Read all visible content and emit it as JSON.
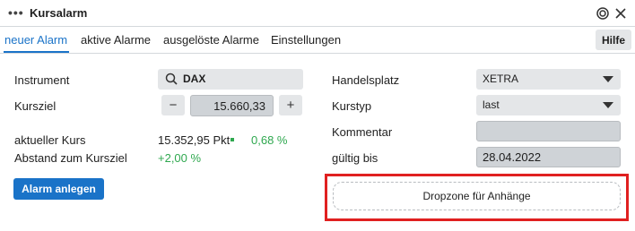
{
  "window": {
    "title": "Kursalarm",
    "menu_icon": "more-dots-icon",
    "settings_icon": "ring-icon",
    "close_icon": "close-icon"
  },
  "tabs": [
    {
      "label": "neuer Alarm",
      "active": true
    },
    {
      "label": "aktive Alarme",
      "active": false
    },
    {
      "label": "ausgelöste Alarme",
      "active": false
    },
    {
      "label": "Einstellungen",
      "active": false
    }
  ],
  "help_label": "Hilfe",
  "form": {
    "instrument_label": "Instrument",
    "instrument_value": "DAX",
    "kursziel_label": "Kursziel",
    "kursziel_value": "15.660,33",
    "minus": "−",
    "plus": "+",
    "aktueller_kurs_label": "aktueller Kurs",
    "aktueller_kurs_value": "15.352,95 Pkt",
    "aktueller_kurs_change": "0,68 %",
    "abstand_label": "Abstand zum Kursziel",
    "abstand_value": "+2,00 %",
    "create_button": "Alarm anlegen",
    "handelsplatz_label": "Handelsplatz",
    "handelsplatz_value": "XETRA",
    "kurstyp_label": "Kurstyp",
    "kurstyp_value": "last",
    "kommentar_label": "Kommentar",
    "kommentar_value": "",
    "gueltig_label": "gültig bis",
    "gueltig_value": "28.04.2022",
    "dropzone_label": "Dropzone für Anhänge"
  },
  "colors": {
    "accent": "#1a73c8",
    "positive": "#2fa84f",
    "highlight": "#e02020"
  }
}
